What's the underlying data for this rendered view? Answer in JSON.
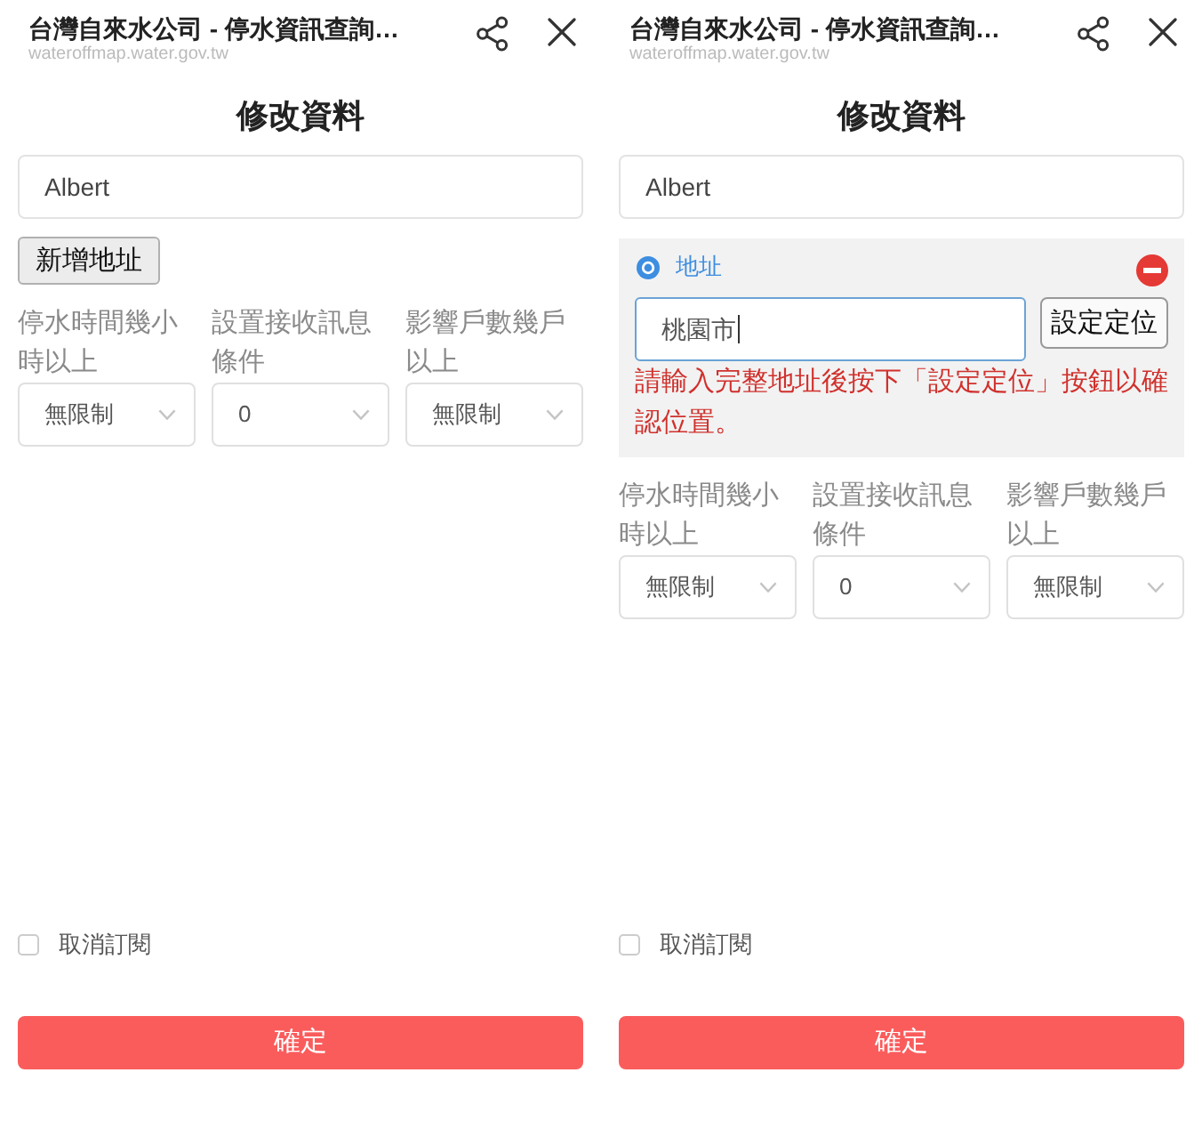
{
  "screens": [
    {
      "header": {
        "title": "台灣自來水公司 - 停水資訊查詢…",
        "url": "wateroffmap.water.gov.tw"
      },
      "heading": "修改資料",
      "name_field": {
        "value": "Albert"
      },
      "add_address_button": "新增地址",
      "filters": [
        {
          "label": "停水時間幾小時以上",
          "value": "無限制"
        },
        {
          "label": "設置接收訊息條件",
          "value": "0"
        },
        {
          "label": "影響戶數幾戶以上",
          "value": "無限制"
        }
      ],
      "unsubscribe": {
        "label": "取消訂閱",
        "checked": false
      },
      "confirm_button": "確定"
    },
    {
      "header": {
        "title": "台灣自來水公司 - 停水資訊查詢…",
        "url": "wateroffmap.water.gov.tw"
      },
      "heading": "修改資料",
      "name_field": {
        "value": "Albert"
      },
      "address": {
        "label": "地址",
        "selected": true,
        "value": "桃園市",
        "focused": true,
        "locate_button": "設定定位",
        "message": "請輸入完整地址後按下「設定定位」按鈕以確認位置。"
      },
      "filters": [
        {
          "label": "停水時間幾小時以上",
          "value": "無限制"
        },
        {
          "label": "設置接收訊息條件",
          "value": "0"
        },
        {
          "label": "影響戶數幾戶以上",
          "value": "無限制"
        }
      ],
      "unsubscribe": {
        "label": "取消訂閱",
        "checked": false
      },
      "confirm_button": "確定"
    }
  ]
}
